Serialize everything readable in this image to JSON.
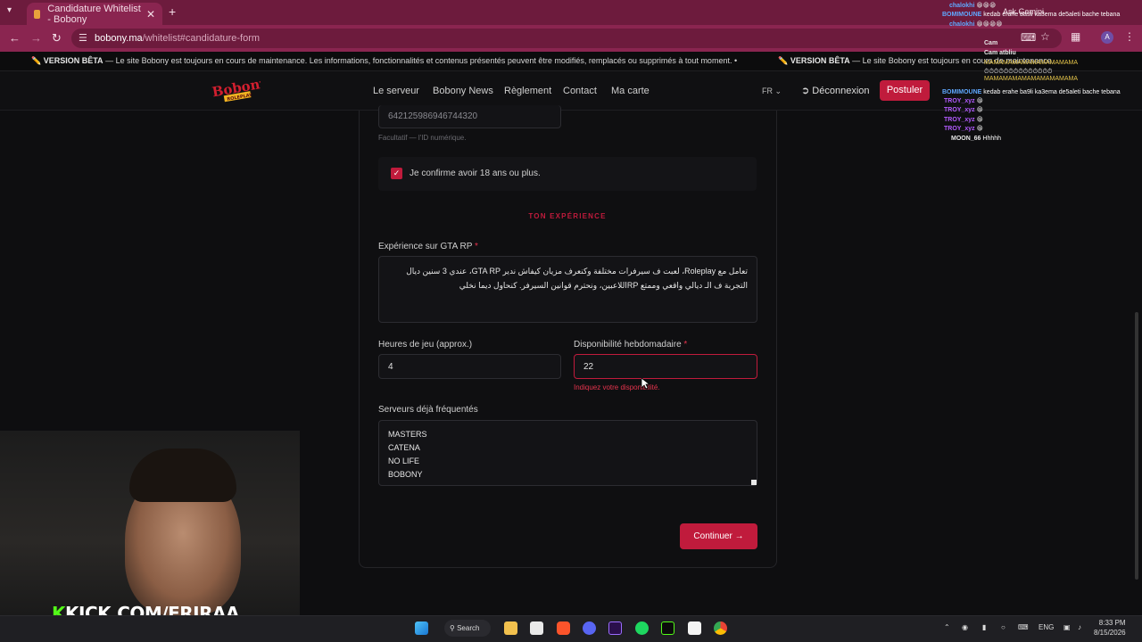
{
  "browser": {
    "tab_title": "Candidature Whitelist - Bobony",
    "url_host": "bobony.ma",
    "url_path": "/whitelist#candidature-form",
    "ask_gemini": "Ask Gemini",
    "profile_initial": "A"
  },
  "banner": {
    "prefix": "VERSION BÊTA",
    "message": " — Le site Bobony est toujours en cours de maintenance. Les informations, fonctionnalités et contenus présentés peuvent être modifiés, remplacés ou supprimés à tout moment.",
    "message_cut": " — Le site Bobony est toujours en cours de maintenance."
  },
  "header": {
    "logo_text": "Bobony",
    "logo_sub": "ROLEPLAY",
    "nav": [
      "Le serveur",
      "Bobony News",
      "Règlement",
      "Contact",
      "Ma carte"
    ],
    "lang": "FR",
    "logout": "Déconnexion",
    "apply": "Postuler"
  },
  "form": {
    "discord_id_value": "642125986946744320",
    "discord_id_hint": "Facultatif — l'ID numérique.",
    "age_confirm": "Je confirme avoir 18 ans ou plus.",
    "age_checked": true,
    "section_title": "TON EXPÉRIENCE",
    "experience_label": "Expérience sur GTA RP",
    "experience_text": "تعامل مع Roleplay، لعبت ف سيرفرات مختلفة وكنعرف مزيان كيفاش ندير GTA RP، عندي 3 سنين ديال التجربة ف الـ ديالي واقعي وممتع RPاللاعبين، ونحترم قوانين السيرفر. كنحاول ديما نخلي",
    "hours_label": "Heures de jeu (approx.)",
    "hours_value": "4",
    "availability_label": "Disponibilité hebdomadaire",
    "availability_value": "22",
    "availability_error": "Indiquez votre disponibilité.",
    "servers_label": "Serveurs déjà fréquentés",
    "servers": [
      "MASTERS",
      "CATENA",
      "NO LIFE",
      "BOBONY"
    ],
    "continue": "Continuer"
  },
  "stream": {
    "kick_prefix": "K",
    "kick_text": "KICK.COM/FRIRAA",
    "chat": [
      {
        "name": "chalokhi",
        "msg": ""
      },
      {
        "name": "BOMIMOUNE",
        "msg": "kedab erahe basli ka3ema de5aleti bache tebana"
      },
      {
        "name": "chalokhi",
        "msg": ""
      },
      {
        "name": "Cam",
        "msg": ""
      },
      {
        "name": "",
        "msg": "Cam atbliu"
      },
      {
        "name": "BOMIMOUNE",
        "msg": "kedab erahe ba9li ka3ema de5aleti bache tebana"
      },
      {
        "name": "TROY_xyz",
        "msg": ""
      },
      {
        "name": "TROY_xyz",
        "msg": ""
      },
      {
        "name": "TROY_xyz",
        "msg": ""
      },
      {
        "name": "TROY_xyz",
        "msg": ""
      },
      {
        "name": "MOON_66",
        "msg": "Hhhhh"
      }
    ],
    "spam": "MAMAMAMAMAMAMAMAMAMA"
  },
  "taskbar": {
    "search": "Search",
    "lang": "ENG",
    "time": "8:33 PM",
    "date": "8/15/2026"
  },
  "colors": {
    "accent": "#c01b3c",
    "chrome": "#8a2550",
    "kick_green": "#53fc18"
  }
}
